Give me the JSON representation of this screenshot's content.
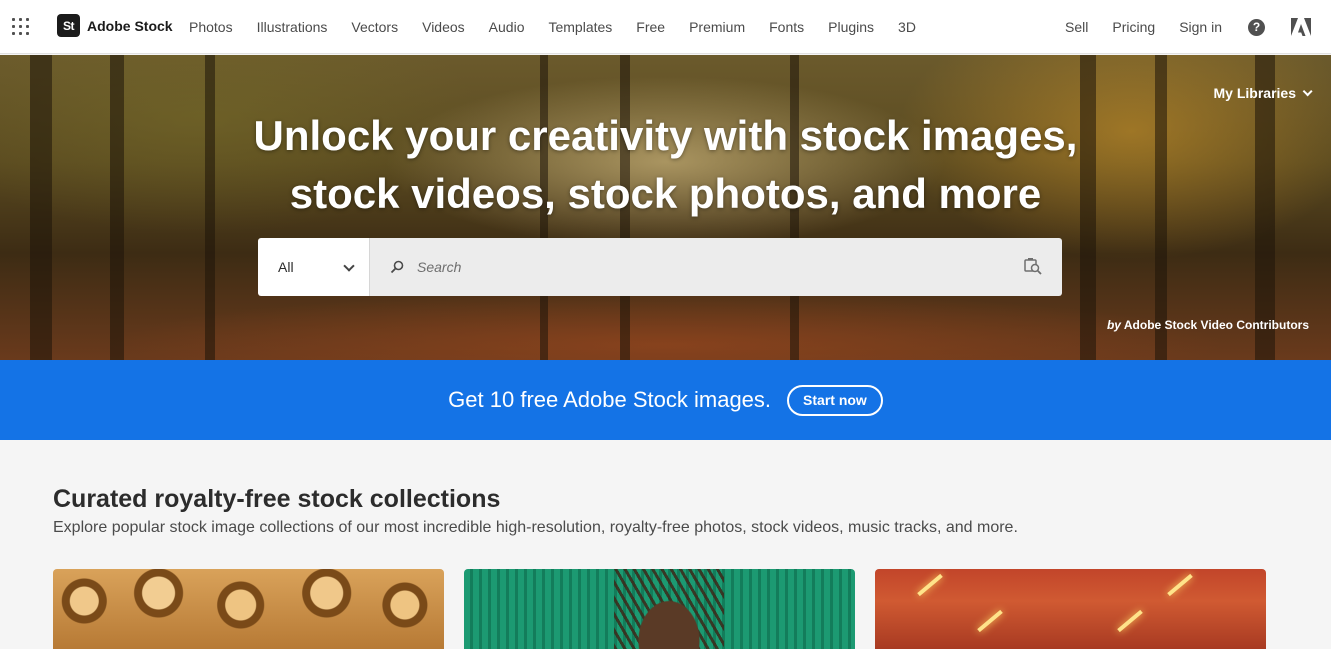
{
  "brand": {
    "logo_mark": "St",
    "name": "Adobe Stock"
  },
  "nav": {
    "links": [
      "Photos",
      "Illustrations",
      "Vectors",
      "Videos",
      "Audio",
      "Templates",
      "Free",
      "Premium",
      "Fonts",
      "Plugins",
      "3D"
    ],
    "right": [
      "Sell",
      "Pricing",
      "Sign in"
    ],
    "icons": [
      "apps-grid-icon",
      "help-icon",
      "adobe-logo-icon"
    ]
  },
  "hero": {
    "title_line1": "Unlock your creativity with stock images,",
    "title_line2": "stock videos, stock photos, and more",
    "my_libraries": "My Libraries",
    "credit_by": "by",
    "credit_name": "Adobe Stock Video Contributors"
  },
  "search": {
    "category": "All",
    "placeholder": "Search",
    "value": ""
  },
  "promo": {
    "text": "Get 10 free Adobe Stock images.",
    "button": "Start now",
    "color": "#1473e6"
  },
  "collections": {
    "title": "Curated royalty-free stock collections",
    "subtitle": "Explore popular stock image collections of our most incredible high-resolution, royalty-free photos, stock videos, music tracks, and more."
  }
}
